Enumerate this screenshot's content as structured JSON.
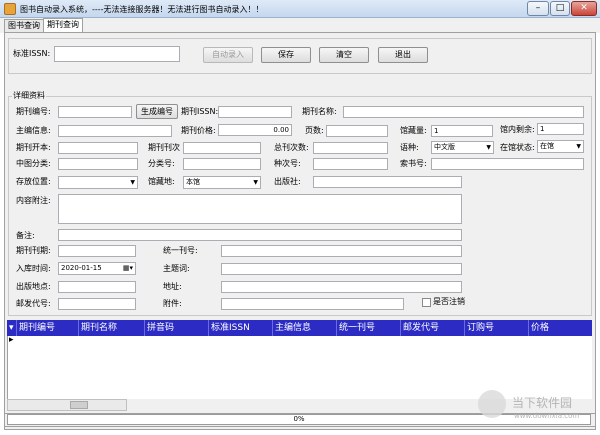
{
  "window": {
    "title": "图书自动录入系统，----无法连接服务器！无法进行图书自动录入！！",
    "minimize": "–",
    "maximize": "□",
    "close": "✕"
  },
  "tabs": [
    "图书查询",
    "期刊查询"
  ],
  "issn_bar": {
    "label": "标准ISSN:",
    "value": "",
    "buttons": {
      "auto": "自动录入",
      "save": "保存",
      "clear": "清空",
      "exit": "退出"
    }
  },
  "details": {
    "group_label": "详细资料",
    "gen_button": "生成编号",
    "fields": {
      "journal_no": {
        "label": "期刊编号:",
        "value": ""
      },
      "issn": {
        "label": "期刊ISSN:",
        "value": ""
      },
      "journal_name": {
        "label": "期刊名称:",
        "value": ""
      },
      "editor": {
        "label": "主编信息:",
        "value": ""
      },
      "price": {
        "label": "期刊价格:",
        "value": "0.00"
      },
      "pages": {
        "label": "页数:",
        "value": ""
      },
      "holdings": {
        "label": "馆藏量:",
        "value": "1"
      },
      "remaining": {
        "label": "馆内剩余:",
        "value": "1"
      },
      "format": {
        "label": "期刊开本:",
        "value": ""
      },
      "issue": {
        "label": "期刊刊次",
        "value": ""
      },
      "total_issue": {
        "label": "总刊次数:",
        "value": ""
      },
      "language": {
        "label": "语种:",
        "value": "中文版"
      },
      "status": {
        "label": "在馆状态:",
        "value": "在馆"
      },
      "clc": {
        "label": "中图分类:",
        "value": ""
      },
      "category": {
        "label": "分类号:",
        "value": ""
      },
      "kind": {
        "label": "种次号:",
        "value": ""
      },
      "call_no": {
        "label": "索书号:",
        "value": ""
      },
      "location": {
        "label": "存放位置:",
        "value": ""
      },
      "library": {
        "label": "馆藏地:",
        "value": "本馆"
      },
      "publisher": {
        "label": "出版社:",
        "value": ""
      },
      "notes": {
        "label": "内容附注:",
        "value": ""
      },
      "remark": {
        "label": "备注:",
        "value": ""
      },
      "period": {
        "label": "期刊刊期:",
        "value": ""
      },
      "unified": {
        "label": "统一刊号:",
        "value": ""
      },
      "entry_date": {
        "label": "入库时间:",
        "value": "2020-01-15"
      },
      "subject": {
        "label": "主题词:",
        "value": ""
      },
      "pub_place": {
        "label": "出版地点:",
        "value": ""
      },
      "address": {
        "label": "地址:",
        "value": ""
      },
      "postal": {
        "label": "邮发代号:",
        "value": ""
      },
      "attach": {
        "label": "附件:",
        "value": ""
      },
      "cancel": {
        "label": "是否注销",
        "checked": false
      }
    }
  },
  "grid": {
    "columns": [
      "期刊编号",
      "期刊名称",
      "拼音码",
      "标准ISSN",
      "主编信息",
      "统一刊号",
      "邮发代号",
      "订购号",
      "价格"
    ],
    "header_color": "#2c2cc4",
    "row_pointer": "▸"
  },
  "status": {
    "progress": "0%",
    "progress_value": 0
  },
  "watermark": {
    "name": "当下软件园",
    "url": "www.downxia.com"
  }
}
